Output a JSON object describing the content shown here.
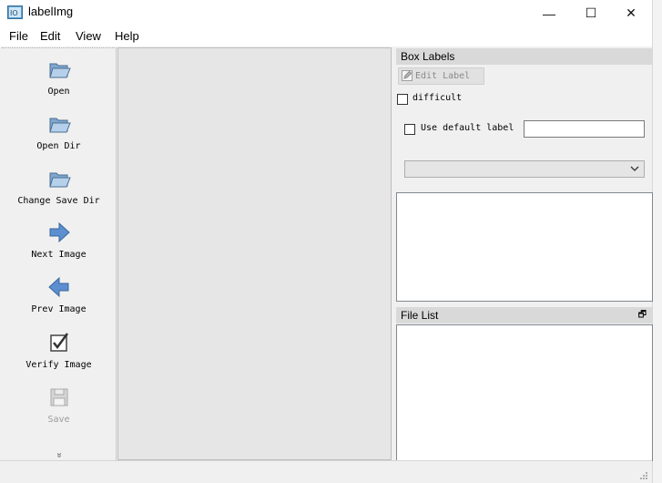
{
  "window": {
    "title": "labelImg",
    "minimize_symbol": "—",
    "maximize_symbol": "☐",
    "close_symbol": "✕"
  },
  "menu": {
    "items": [
      "File",
      "Edit",
      "View",
      "Help"
    ]
  },
  "toolbar": {
    "items": [
      {
        "label": "Open",
        "icon": "folder-open-icon",
        "enabled": true
      },
      {
        "label": "Open Dir",
        "icon": "folder-open-icon",
        "enabled": true
      },
      {
        "label": "Change Save Dir",
        "icon": "folder-open-icon",
        "enabled": true
      },
      {
        "label": "Next Image",
        "icon": "arrow-right-icon",
        "enabled": true
      },
      {
        "label": "Prev Image",
        "icon": "arrow-left-icon",
        "enabled": true
      },
      {
        "label": "Verify Image",
        "icon": "checkbox-icon",
        "enabled": true
      },
      {
        "label": "Save",
        "icon": "floppy-disk-icon",
        "enabled": false
      }
    ],
    "more_symbol": "»"
  },
  "box_labels": {
    "title": "Box Labels",
    "edit_label_button": "Edit Label",
    "difficult_label": "difficult",
    "difficult_checked": false,
    "use_default_label": "Use default label",
    "use_default_checked": false,
    "default_label_value": "",
    "label_combo_value": ""
  },
  "file_list": {
    "title": "File List",
    "float_symbol": "🗗"
  },
  "colors": {
    "panel_bg": "#f0f0f0",
    "canvas_bg": "#e6e6e6",
    "dock_title_bg": "#d9d9d9",
    "folder_color": "#8fb3d6",
    "arrow_color": "#4f86c6"
  }
}
